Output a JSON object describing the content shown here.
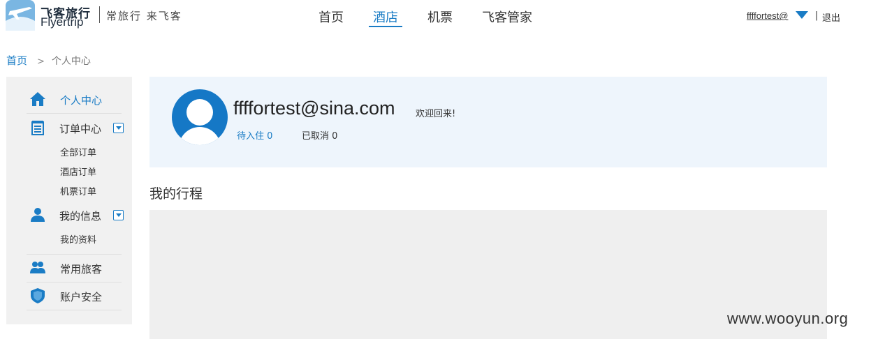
{
  "header": {
    "logo_cn": "飞客旅行",
    "logo_en": "Flyertrip",
    "slogan": "常旅行 来飞客",
    "nav": [
      {
        "label": "首页"
      },
      {
        "label": "酒店"
      },
      {
        "label": "机票"
      },
      {
        "label": "飞客管家"
      }
    ],
    "active_nav": "酒店",
    "user": "ffffortest@",
    "separator": "|",
    "logout": "退出"
  },
  "breadcrumb": {
    "home": "首页",
    "separator": ">",
    "current": "个人中心"
  },
  "sidebar": {
    "personal_center": "个人中心",
    "orders": {
      "label": "订单中心",
      "items": [
        "全部订单",
        "酒店订单",
        "机票订单"
      ]
    },
    "my_info": {
      "label": "我的信息",
      "items": [
        "我的资料"
      ]
    },
    "travelers": "常用旅客",
    "security": "账户安全"
  },
  "profile": {
    "email": "ffffortest@sina.com",
    "welcome": "欢迎回来!",
    "pending": "待入住 0",
    "cancelled": "已取消 0"
  },
  "trips": {
    "title": "我的行程"
  },
  "watermark": "www.wooyun.org",
  "colors": {
    "accent": "#1a7cc5",
    "profile_bg": "#eef5fc",
    "sidebar_bg": "#f1f1f1",
    "trip_bg": "#efefef"
  }
}
